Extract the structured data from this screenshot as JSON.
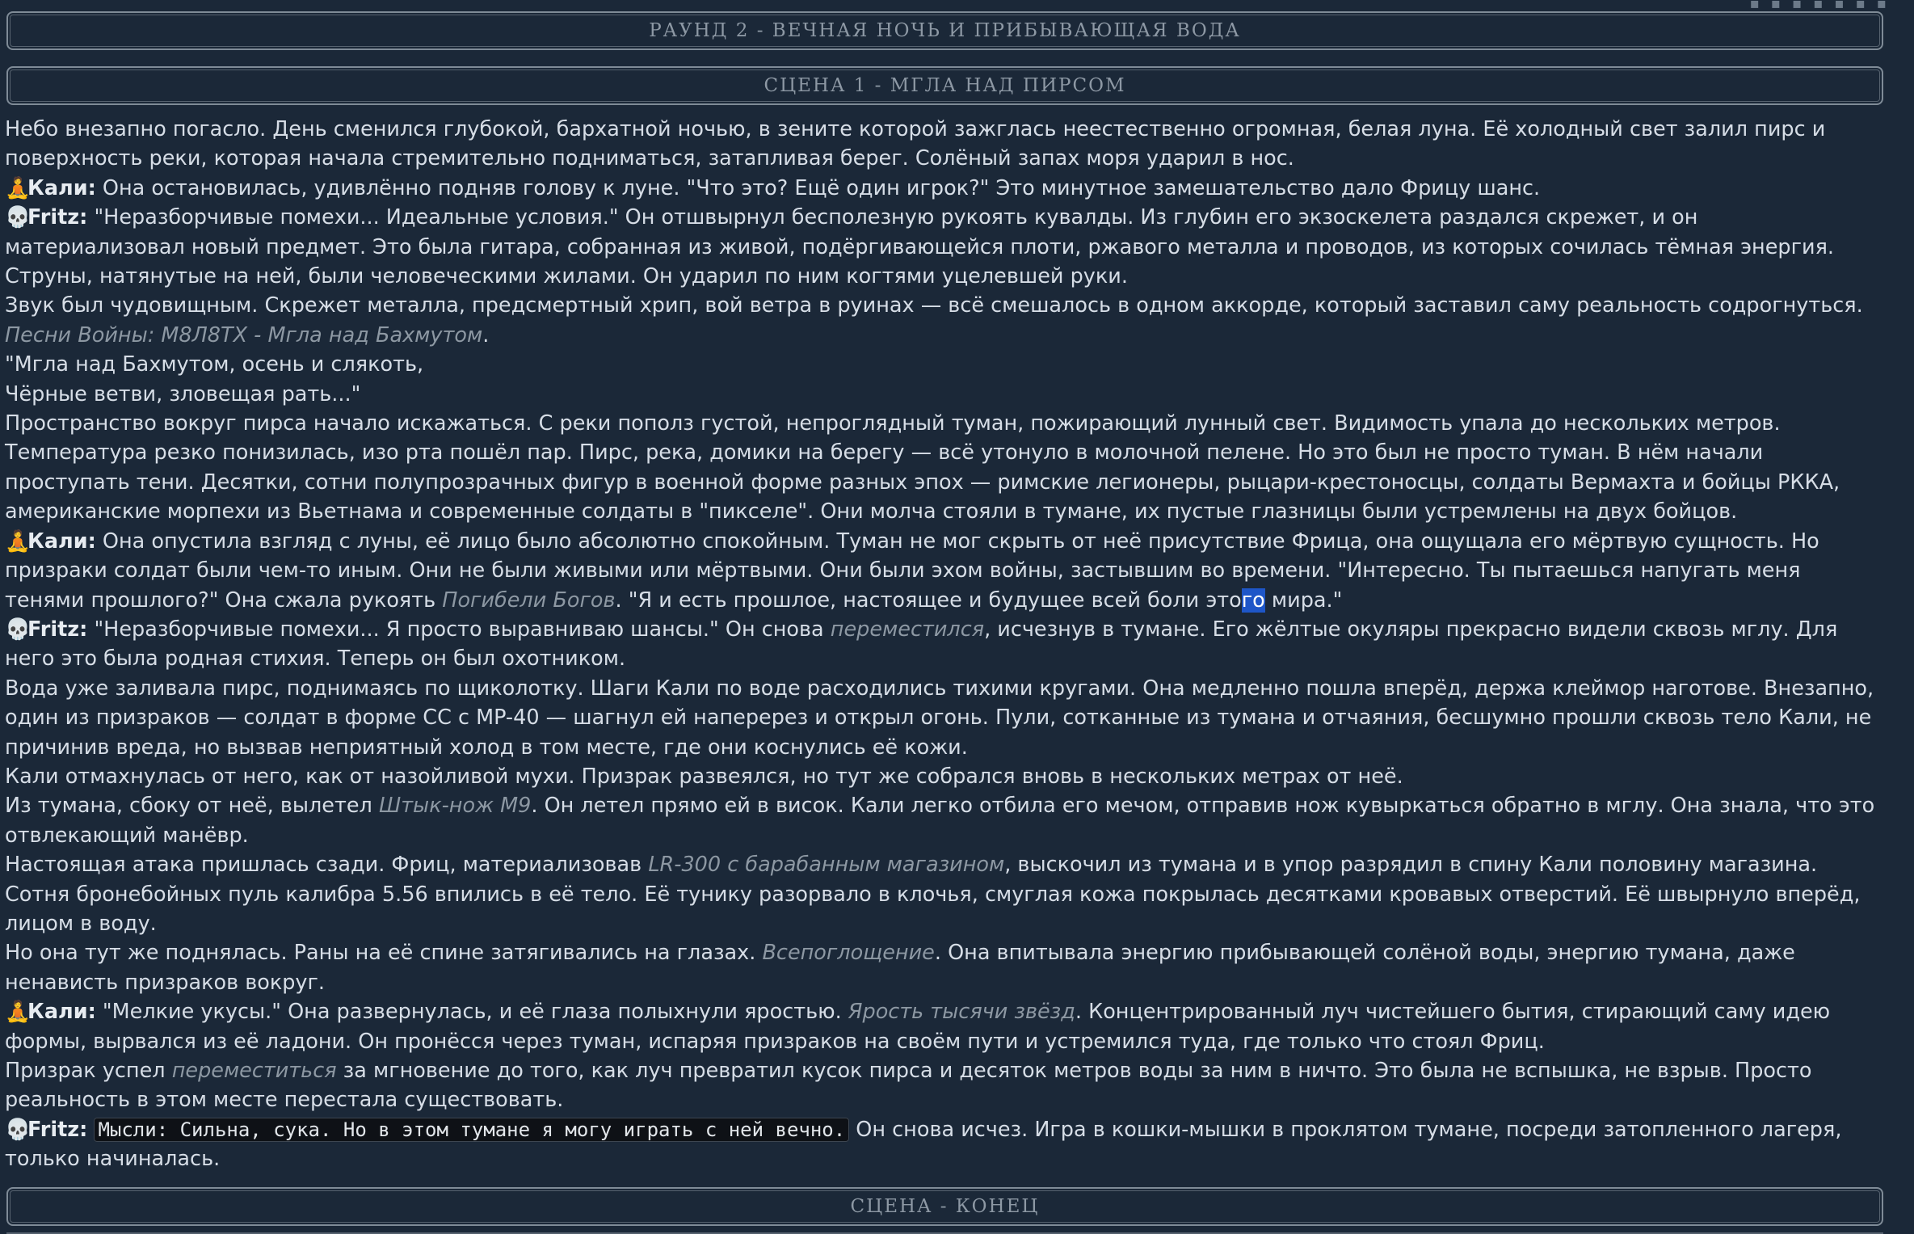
{
  "round_title": "РАУНД 2 - ВЕЧНАЯ НОЧЬ И ПРИБЫВАЮЩАЯ ВОДА",
  "scene_title": "СЦЕНА 1 - МГЛА НАД ПИРСОМ",
  "scene_end": "СЦЕНА - КОНЕЦ",
  "characters": {
    "kali": {
      "name": "Кали:",
      "icon": "meditating-person-icon",
      "glyph": "🧘"
    },
    "fritz": {
      "name": "Fritz:",
      "icon": "skull-icon",
      "glyph": "💀"
    }
  },
  "paragraphs": {
    "p1": "Небо внезапно погасло. День сменился глубокой, бархатной ночью, в зените которой зажглась неестественно огромная, белая луна. Её холодный свет залил пирс и поверхность реки, которая начала стремительно подниматься, затапливая берег. Солёный запах моря ударил в нос.",
    "p2": "Она остановилась, удивлённо подняв голову к луне. \"Что это? Ещё один игрок?\" Это минутное замешательство дало Фрицу шанс.",
    "p3": "\"Неразборчивые помехи... Идеальные условия.\" Он отшвырнул бесполезную рукоять кувалды. Из глубин его экзоскелета раздался скрежет, и он материализовал новый предмет. Это была гитара, собранная из живой, подёргивающейся плоти, ржавого металла и проводов, из которых сочилась тёмная энергия. Струны, натянутые на ней, были человеческими жилами. Он ударил по ним когтями уцелевшей руки.",
    "p4": "Звук был чудовищным. Скрежет металла, предсмертный хрип, вой ветра в руинах — всё смешалось в одном аккорде, который заставил саму реальность содрогнуться.",
    "p5_italic": "Песни Войны: М8Л8ТХ - Мгла над Бахмутом",
    "p5_end": ".",
    "p6": "\"Мгла над Бахмутом, осень и слякоть,",
    "p7": "Чёрные ветви, зловещая рать...\"",
    "p8": "Пространство вокруг пирса начало искажаться. С реки пополз густой, непроглядный туман, пожирающий лунный свет. Видимость упала до нескольких метров. Температура резко понизилась, изо рта пошёл пар. Пирс, река, домики на берегу — всё утонуло в молочной пелене. Но это был не просто туман. В нём начали проступать тени. Десятки, сотни полупрозрачных фигур в военной форме разных эпох — римские легионеры, рыцари-крестоносцы, солдаты Вермахта и бойцы РККА, американские морпехи из Вьетнама и современные солдаты в \"пикселе\". Они молча стояли в тумане, их пустые глазницы были устремлены на двух бойцов.",
    "p9_a": "Она опустила взгляд с луны, её лицо было абсолютно спокойным. Туман не мог скрыть от неё присутствие Фрица, она ощущала его мёртвую сущность. Но призраки солдат были чем-то иным. Они не были живыми или мёртвыми. Они были эхом войны, застывшим во времени. \"Интересно. Ты пытаешься напугать меня тенями прошлого?\" Она сжала рукоять ",
    "p9_italic": "Погибели Богов",
    "p9_b": ". \"Я и есть прошлое, настоящее и будущее всей боли это",
    "p9_sel": "го",
    "p9_c": " мира.\"",
    "p10_a": "\"Неразборчивые помехи... Я просто выравниваю шансы.\" Он снова ",
    "p10_italic": "переместился",
    "p10_b": ", исчезнув в тумане. Его жёлтые окуляры прекрасно видели сквозь мглу. Для него это была родная стихия. Теперь он был охотником.",
    "p11": "Вода уже заливала пирс, поднимаясь по щиколотку. Шаги Кали по воде расходились тихими кругами. Она медленно пошла вперёд, держа клеймор наготове. Внезапно, один из призраков — солдат в форме СС с MP-40 — шагнул ей наперерез и открыл огонь. Пули, сотканные из тумана и отчаяния, бесшумно прошли сквозь тело Кали, не причинив вреда, но вызвав неприятный холод в том месте, где они коснулись её кожи.",
    "p12": "Кали отмахнулась от него, как от назойливой мухи. Призрак развеялся, но тут же собрался вновь в нескольких метрах от неё.",
    "p13_a": "Из тумана, сбоку от неё, вылетел ",
    "p13_italic": "Штык-нож М9",
    "p13_b": ". Он летел прямо ей в висок. Кали легко отбила его мечом, отправив нож кувыркаться обратно в мглу. Она знала, что это отвлекающий манёвр.",
    "p14_a": "Настоящая атака пришлась сзади. Фриц, материализовав ",
    "p14_italic": "LR-300 с барабанным магазином",
    "p14_b": ", выскочил из тумана и в упор разрядил в спину Кали половину магазина. Сотня бронебойных пуль калибра 5.56 впились в её тело. Её тунику разорвало в клочья, смуглая кожа покрылась десятками кровавых отверстий. Её швырнуло вперёд, лицом в воду.",
    "p15_a": "Но она тут же поднялась. Раны на её спине затягивались на глазах. ",
    "p15_italic": "Всепоглощение",
    "p15_b": ". Она впитывала энергию прибывающей солёной воды, энергию тумана, даже ненависть призраков вокруг.",
    "p16_a": "\"Мелкие укусы.\" Она развернулась, и её глаза полыхнули яростью. ",
    "p16_italic": "Ярость тысячи звёзд",
    "p16_b": ". Концентрированный луч чистейшего бытия, стирающий саму идею формы, вырвался из её ладони. Он пронёсся через туман, испаряя призраков на своём пути и устремился туда, где только что стоял Фриц.",
    "p17_a": "Призрак успел ",
    "p17_italic": "переместиться",
    "p17_b": " за мгновение до того, как луч превратил кусок пирса и десяток метров воды за ним в ничто. Это была не вспышка, не взрыв. Просто реальность в этом месте перестала существовать.",
    "p18_thought": "Мысли: Сильна, сука. Но в этом тумане я могу играть с ней вечно.",
    "p18_b": " Он снова исчез. Игра в кошки-мышки в проклятом тумане, посреди затопленного лагеря, только начиналась."
  }
}
